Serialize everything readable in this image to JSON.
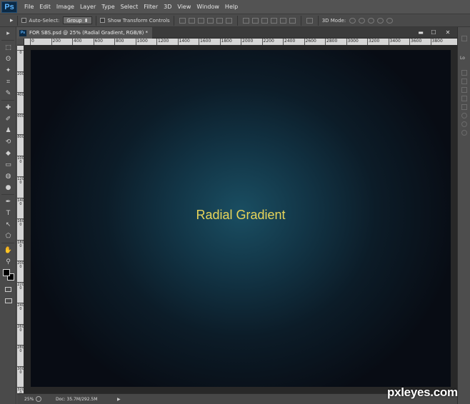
{
  "menu": {
    "logo": "Ps",
    "items": [
      "File",
      "Edit",
      "Image",
      "Layer",
      "Type",
      "Select",
      "Filter",
      "3D",
      "View",
      "Window",
      "Help"
    ]
  },
  "options": {
    "tool_glyph": "▸",
    "auto_select_label": "Auto-Select:",
    "auto_select_value": "Group",
    "show_transform_label": "Show Transform Controls",
    "mode_label": "3D Mode:"
  },
  "tools": [
    "▸",
    "⬚",
    "ʘ",
    "✦",
    "⌗",
    "✎",
    "✚",
    "✐",
    "♟",
    "⟲",
    "◆",
    "▭",
    "◍",
    "●",
    "✒",
    "T",
    "↖",
    "⬠",
    "✋",
    "⚲"
  ],
  "document": {
    "tab_title": "FOR SBS.psd @ 25% (Radial Gradient, RGB/8) *",
    "tab_icon": "Ps",
    "ruler_h": [
      "0",
      "200",
      "400",
      "600",
      "800",
      "1000",
      "1200",
      "1400",
      "1600",
      "1800",
      "2000",
      "2200",
      "2400",
      "2600",
      "2800",
      "3000",
      "3200",
      "3400",
      "3600",
      "3800"
    ],
    "ruler_v": [
      "0",
      "200",
      "400",
      "600",
      "800",
      "1000",
      "1200",
      "1400",
      "1600",
      "1800",
      "2000",
      "2200",
      "2400",
      "2600",
      "2800",
      "3000",
      "3200"
    ],
    "canvas_text": "Radial Gradient",
    "canvas_colors": {
      "center": "#1a4e62",
      "edge": "#080c14",
      "text": "#e8d55a"
    }
  },
  "status": {
    "zoom": "25%",
    "doc_info": "Doc: 35.7M/292.5M",
    "arrow": "▶"
  },
  "window_controls": {
    "minimize": "▬",
    "maximize": "☐",
    "close": "✕"
  },
  "right_panel": {
    "tab_label": "Lo"
  },
  "watermark": "pxleyes.com"
}
